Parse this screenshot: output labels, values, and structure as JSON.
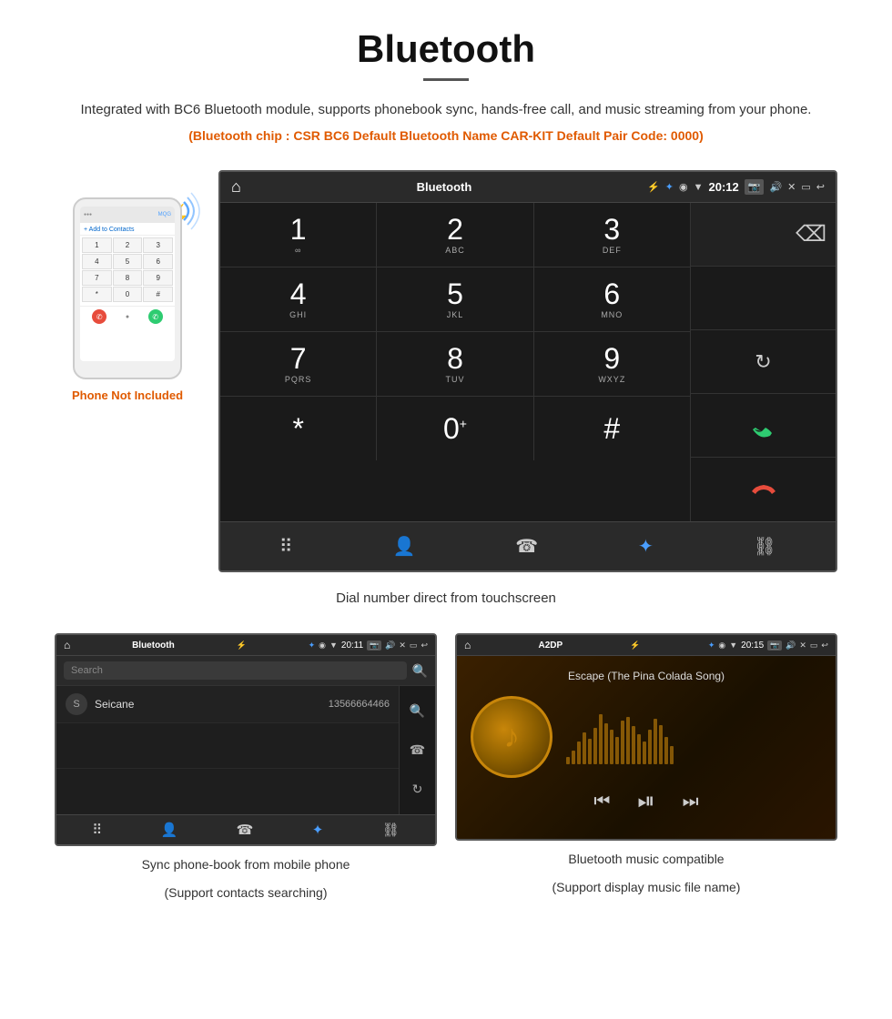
{
  "header": {
    "title": "Bluetooth",
    "description": "Integrated with BC6 Bluetooth module, supports phonebook sync, hands-free call, and music streaming from your phone.",
    "specs": "(Bluetooth chip : CSR BC6    Default Bluetooth Name CAR-KIT    Default Pair Code: 0000)"
  },
  "car_screen": {
    "status_bar": {
      "title": "Bluetooth",
      "time": "20:12"
    },
    "dialer": {
      "keys": [
        {
          "number": "1",
          "letters": ""
        },
        {
          "number": "2",
          "letters": "ABC"
        },
        {
          "number": "3",
          "letters": "DEF"
        },
        {
          "number": "4",
          "letters": "GHI"
        },
        {
          "number": "5",
          "letters": "JKL"
        },
        {
          "number": "6",
          "letters": "MNO"
        },
        {
          "number": "7",
          "letters": "PQRS"
        },
        {
          "number": "8",
          "letters": "TUV"
        },
        {
          "number": "9",
          "letters": "WXYZ"
        },
        {
          "number": "*",
          "letters": ""
        },
        {
          "number": "0",
          "letters": "+"
        },
        {
          "number": "#",
          "letters": ""
        }
      ]
    }
  },
  "phone_illustration": {
    "label": "Phone Not Included"
  },
  "caption": "Dial number direct from touchscreen",
  "phonebook_screen": {
    "status_bar": {
      "title": "Bluetooth",
      "time": "20:11"
    },
    "search_placeholder": "Search",
    "contacts": [
      {
        "initial": "S",
        "name": "Seicane",
        "number": "13566664466"
      }
    ]
  },
  "music_screen": {
    "status_bar": {
      "title": "A2DP",
      "time": "20:15"
    },
    "song_title": "Escape (The Pina Colada Song)"
  },
  "bottom_captions": {
    "left_main": "Sync phone-book from mobile phone",
    "left_sub": "(Support contacts searching)",
    "right_main": "Bluetooth music compatible",
    "right_sub": "(Support display music file name)"
  },
  "visualizer_heights": [
    8,
    15,
    25,
    35,
    28,
    40,
    55,
    45,
    38,
    30,
    48,
    52,
    42,
    33,
    25,
    38,
    50,
    43,
    30,
    20
  ]
}
